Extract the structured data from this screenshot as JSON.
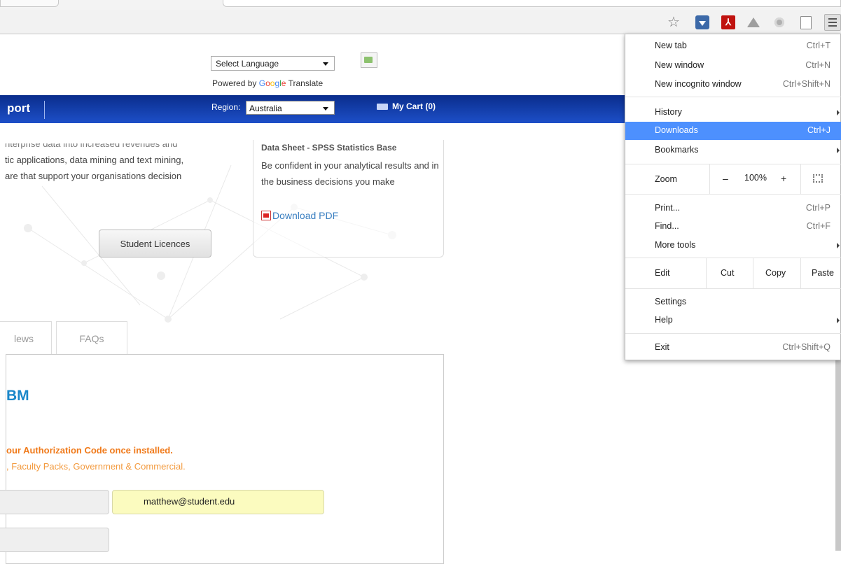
{
  "browser": {
    "toolbar_icons": [
      "star-bookmark-icon",
      "download-extension-icon",
      "adobe-pdf-icon",
      "drive-icon",
      "robot-extension-icon",
      "page-icon",
      "hamburger-menu-icon"
    ]
  },
  "page": {
    "language_select": {
      "value": "Select Language"
    },
    "powered_by": {
      "prefix": "Powered by",
      "google": [
        "G",
        "o",
        "o",
        "g",
        "l",
        "e"
      ],
      "suffix": "Translate"
    },
    "nav": {
      "support_label": "port",
      "region_label": "Region:",
      "region_value": "Australia",
      "cart_label": "My Cart (0)"
    },
    "hero": {
      "line1": "nterprise data into increased revenues and",
      "line2": "tic applications, data mining and text mining,",
      "line3": "are that support your organisations decision"
    },
    "student_button": "Student Licences",
    "datasheet": {
      "title": "Data Sheet - SPSS Statistics Base",
      "description": "Be confident in your analytical results and in the business decisions you make",
      "link": "Download PDF"
    },
    "tabs": {
      "news": "lews",
      "faqs": "FAQs"
    },
    "content": {
      "heading": "BM",
      "auth_text": "our Authorization Code once installed.",
      "packs_text": ", Faculty Packs, Government & Commercial.",
      "email_value": "matthew@student.edu"
    }
  },
  "menu": {
    "new_tab": {
      "label": "New tab",
      "shortcut": "Ctrl+T"
    },
    "new_window": {
      "label": "New window",
      "shortcut": "Ctrl+N"
    },
    "new_incognito": {
      "label": "New incognito window",
      "shortcut": "Ctrl+Shift+N"
    },
    "history": {
      "label": "History"
    },
    "downloads": {
      "label": "Downloads",
      "shortcut": "Ctrl+J"
    },
    "bookmarks": {
      "label": "Bookmarks"
    },
    "zoom": {
      "label": "Zoom",
      "minus": "–",
      "value": "100%",
      "plus": "+"
    },
    "print": {
      "label": "Print...",
      "shortcut": "Ctrl+P"
    },
    "find": {
      "label": "Find...",
      "shortcut": "Ctrl+F"
    },
    "more_tools": {
      "label": "More tools"
    },
    "edit": {
      "label": "Edit",
      "cut": "Cut",
      "copy": "Copy",
      "paste": "Paste"
    },
    "settings": {
      "label": "Settings"
    },
    "help": {
      "label": "Help"
    },
    "exit": {
      "label": "Exit",
      "shortcut": "Ctrl+Shift+Q"
    }
  },
  "colors": {
    "nav_gradient_top": "#0a2d8c",
    "nav_gradient_bottom": "#1d4fc8",
    "menu_highlight": "#4d90fe",
    "heading_blue": "#1a87c9",
    "orange_text": "#f07a1a",
    "email_field_bg": "#fbfbbf"
  }
}
